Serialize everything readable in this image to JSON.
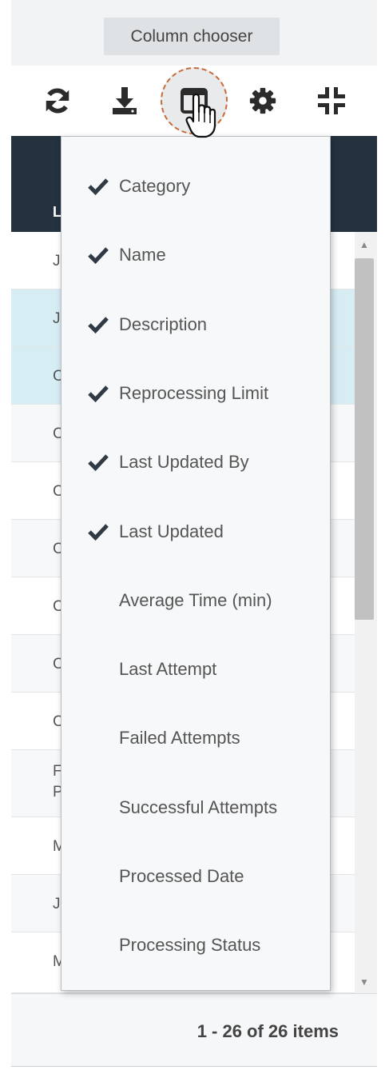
{
  "tooltip": {
    "text": "Column chooser"
  },
  "toolbar": {
    "buttons": [
      {
        "icon": "refresh-icon"
      },
      {
        "icon": "download-icon"
      },
      {
        "icon": "column-chooser-icon",
        "active": true
      },
      {
        "icon": "gear-icon"
      },
      {
        "icon": "collapse-icon"
      }
    ]
  },
  "grid": {
    "header_partial": "L",
    "rows": [
      {
        "text": "Ja",
        "selected": false
      },
      {
        "text": "Ja",
        "selected": true
      },
      {
        "text": "C",
        "selected": true
      },
      {
        "text": "C",
        "selected": false
      },
      {
        "text": "C",
        "selected": false
      },
      {
        "text": "C",
        "selected": false
      },
      {
        "text": "C",
        "selected": false
      },
      {
        "text": "C",
        "selected": false
      },
      {
        "text": "C",
        "selected": false
      },
      {
        "text": "F",
        "text2": "P",
        "selected": false
      },
      {
        "text": "M",
        "selected": false
      },
      {
        "text": "Ju",
        "selected": false
      },
      {
        "text": "M",
        "selected": false
      }
    ]
  },
  "column_chooser": {
    "items": [
      {
        "label": "Category",
        "checked": true
      },
      {
        "label": "Name",
        "checked": true
      },
      {
        "label": "Description",
        "checked": true
      },
      {
        "label": "Reprocessing Limit",
        "checked": true
      },
      {
        "label": "Last Updated By",
        "checked": true
      },
      {
        "label": "Last Updated",
        "checked": true
      },
      {
        "label": "Average Time (min)",
        "checked": false
      },
      {
        "label": "Last Attempt",
        "checked": false
      },
      {
        "label": "Failed Attempts",
        "checked": false
      },
      {
        "label": "Successful Attempts",
        "checked": false
      },
      {
        "label": "Processed Date",
        "checked": false
      },
      {
        "label": "Processing Status",
        "checked": false
      }
    ]
  },
  "pager": {
    "info": "1 - 26 of 26 items"
  },
  "colors": {
    "header_dark": "#243240",
    "selected_row": "#d7edf4",
    "active_ring": "#c8693a",
    "icon": "#2b2b2b",
    "check": "#2f3a45"
  }
}
